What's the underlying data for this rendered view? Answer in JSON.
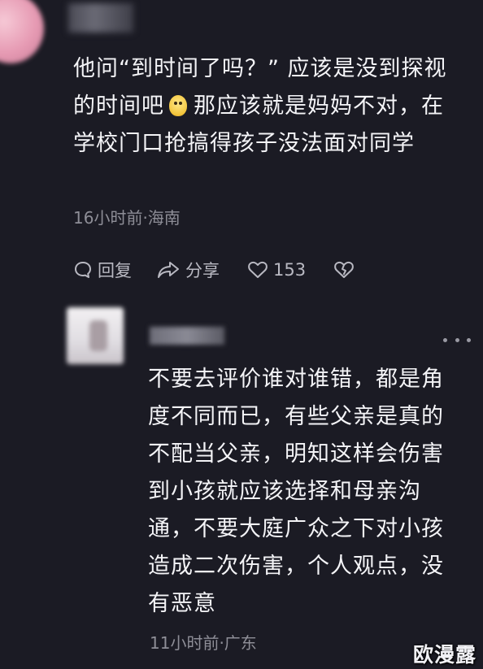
{
  "comment1": {
    "text_part1": "他问“到时间了吗？” 应该是没到探视的时间吧",
    "emoji": "face-emoji",
    "text_part2": "那应该就是妈妈不对，在学校门口抢搞得孩子没法面对同学",
    "meta": "16小时前·海南",
    "actions": {
      "reply_label": "回复",
      "share_label": "分享",
      "like_count": "153"
    }
  },
  "comment2": {
    "text": "不要去评价谁对谁错，都是角度不同而已，有些父亲是真的不配当父亲，明知这样会伤害到小孩就应该选择和母亲沟通，不要大庭广众之下对小孩造成二次伤害，个人观点，没有恶意",
    "meta": "11小时前·广东"
  },
  "watermark": "欧漫露",
  "icons": [
    "reply-icon",
    "share-icon",
    "heart-icon",
    "dislike-heart-icon",
    "more-icon"
  ],
  "colors": {
    "background": "#1b1b24",
    "text": "#f4f4f7",
    "meta": "#8e8e97",
    "action": "#b9b9c2"
  }
}
